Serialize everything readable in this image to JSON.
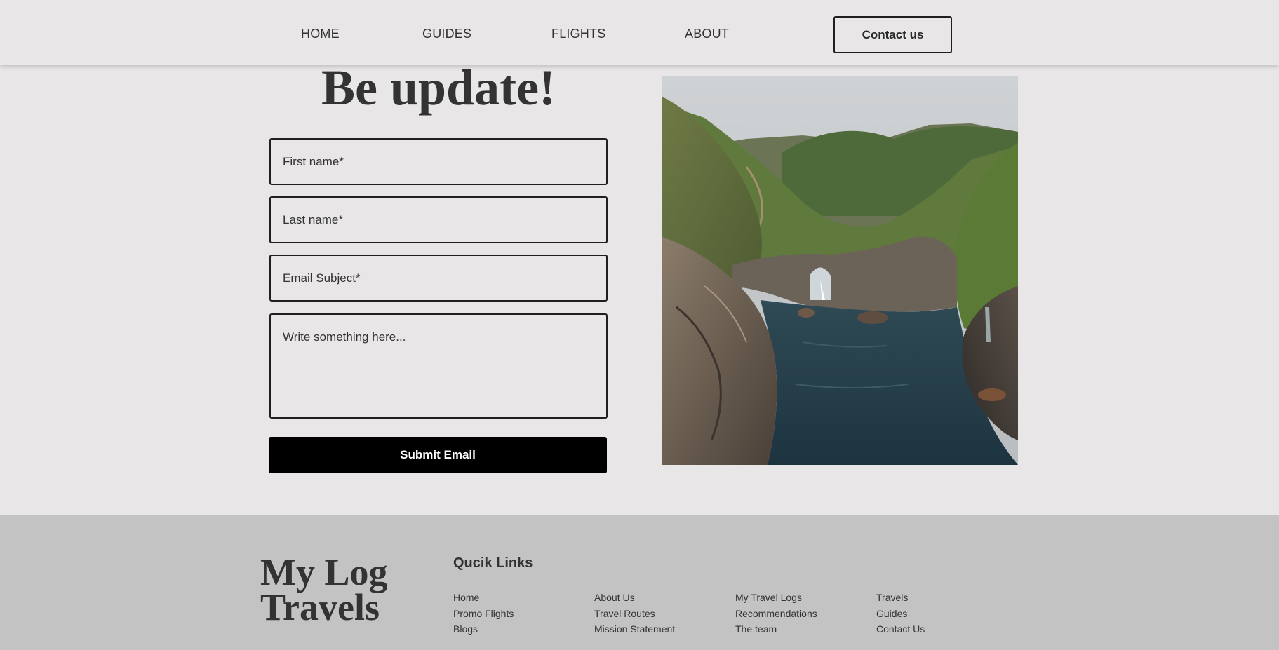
{
  "nav": {
    "items": [
      {
        "label": "HOME"
      },
      {
        "label": "GUIDES"
      },
      {
        "label": "FLIGHTS"
      },
      {
        "label": "ABOUT"
      }
    ],
    "contact_label": "Contact us"
  },
  "main": {
    "title": "Be update!",
    "form": {
      "first_name_placeholder": "First name*",
      "last_name_placeholder": "Last name*",
      "subject_placeholder": "Email Subject*",
      "message_placeholder": "Write something here...",
      "submit_label": "Submit Email"
    }
  },
  "footer": {
    "brand": "My Log Travels",
    "quick_links_title": "Qucik Links",
    "columns": [
      [
        "Home",
        "Promo Flights",
        "Blogs"
      ],
      [
        "About Us",
        "Travel Routes",
        "Mission Statement"
      ],
      [
        "My Travel Logs",
        "Recommendations",
        "The team"
      ],
      [
        "Travels",
        "Guides",
        "Contact Us"
      ]
    ]
  },
  "colors": {
    "page_bg": "#e8e6e7",
    "footer_bg": "#c3c3c3",
    "submit_bg": "#000000",
    "text": "#333333"
  }
}
